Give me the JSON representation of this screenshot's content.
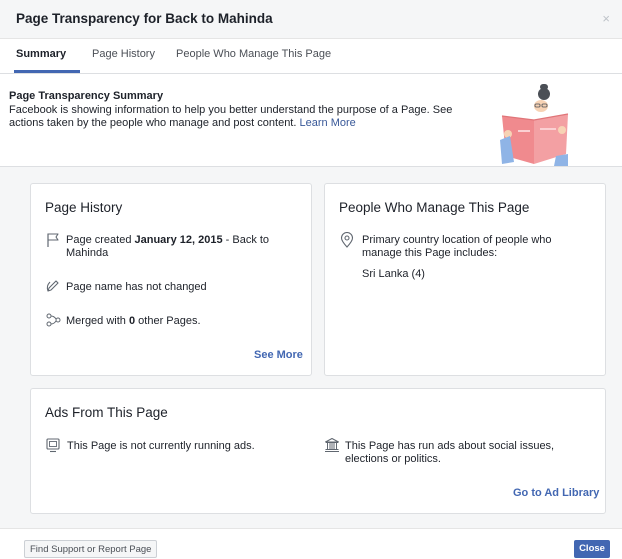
{
  "dialog": {
    "title": "Page Transparency for Back to Mahinda",
    "close_symbol": "×"
  },
  "tabs": [
    {
      "label": "Summary",
      "active": true
    },
    {
      "label": "Page History",
      "active": false
    },
    {
      "label": "People Who Manage This Page",
      "active": false
    }
  ],
  "summary": {
    "title": "Page Transparency Summary",
    "description": "Facebook is showing information to help you better understand the purpose of a Page. See actions taken by the people who manage and post content.",
    "learn_more": "Learn More"
  },
  "page_history": {
    "title": "Page History",
    "created_prefix": "Page created",
    "created_date": "January 12, 2015",
    "created_suffix": "- Back to Mahinda",
    "name_changed": "Page name has not changed",
    "merged_prefix": "Merged with",
    "merged_count": "0",
    "merged_suffix": "other Pages.",
    "see_more": "See More",
    "icons": [
      "flag-icon",
      "pencil-icon",
      "merge-icon"
    ]
  },
  "people": {
    "title": "People Who Manage This Page",
    "country_text": "Primary country location of people who manage this Page includes:",
    "country_value": "Sri Lanka (4)",
    "icons": [
      "location-pin-icon"
    ]
  },
  "ads": {
    "title": "Ads From This Page",
    "not_running": "This Page is not currently running ads.",
    "social_issues": "This Page has run ads about social issues, elections or politics.",
    "ad_library_link": "Go to Ad Library",
    "icons": [
      "ad-screen-icon",
      "government-building-icon"
    ]
  },
  "footer": {
    "report_button": "Find Support or Report Page",
    "close_button": "Close"
  },
  "colors": {
    "link": "#4267b2",
    "primary_button": "#4267b2",
    "header_bg": "#f5f6f7",
    "illustration_book": "#f08a8e"
  }
}
